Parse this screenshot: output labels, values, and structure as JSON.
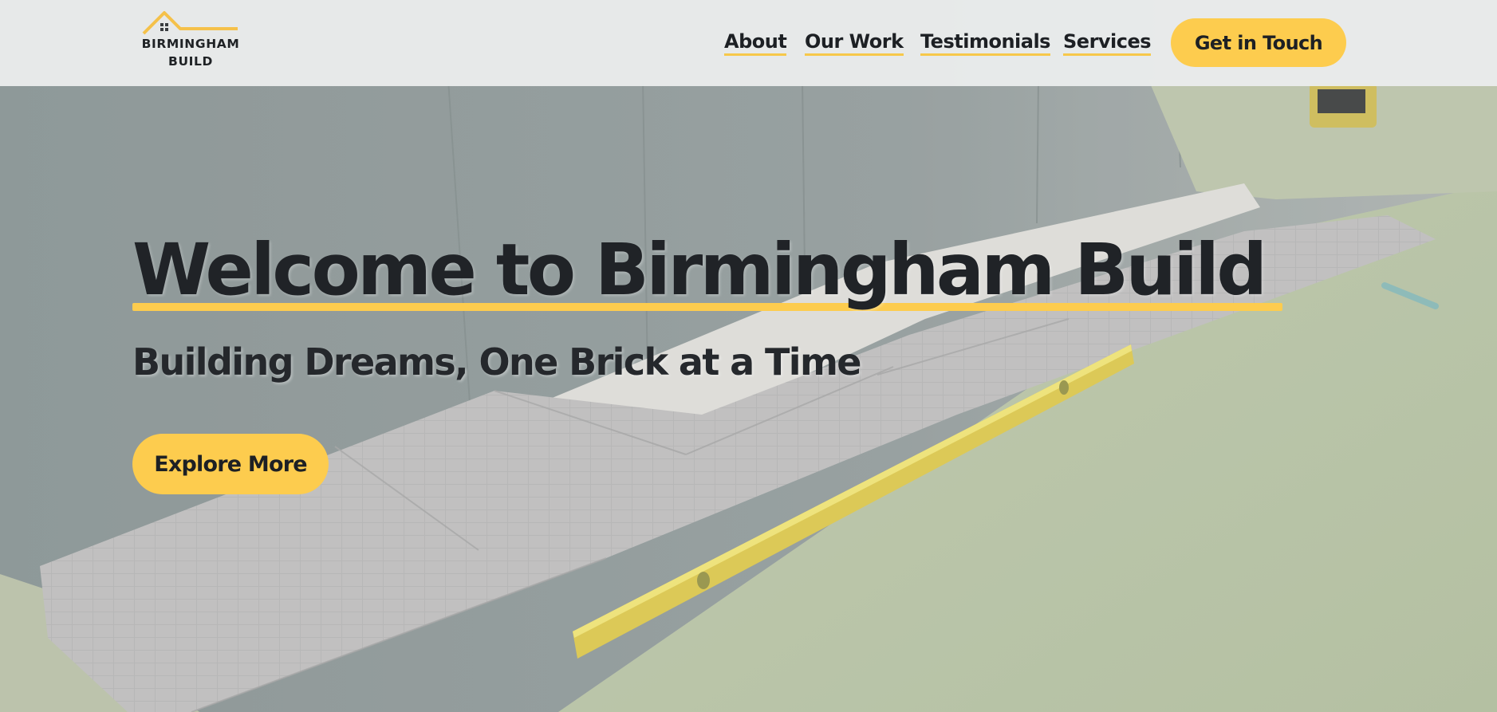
{
  "header": {
    "logo": {
      "line1": "BIRMINGHAM",
      "line2": "BUILD",
      "icon": "house-roof-icon"
    },
    "nav": [
      {
        "label": "About"
      },
      {
        "label": "Our Work"
      },
      {
        "label": "Testimonials"
      },
      {
        "label": "Services"
      }
    ],
    "cta_label": "Get in Touch"
  },
  "hero": {
    "title": "Welcome to Birmingham Build",
    "subtitle": "Building Dreams, One Brick at a Time",
    "button_label": "Explore More",
    "background": "photo-paving-slabs-with-spirit-level"
  },
  "colors": {
    "accent": "#fdcc4e",
    "text": "#1d2024",
    "header_bg": "#eaecec"
  }
}
